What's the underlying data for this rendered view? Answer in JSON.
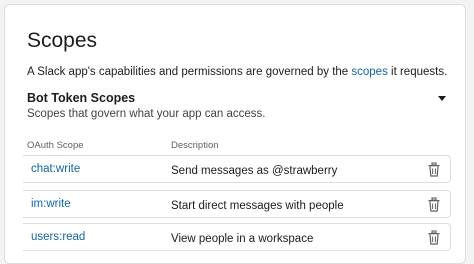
{
  "section": {
    "title": "Scopes",
    "description_prefix": "A Slack app's capabilities and permissions are governed by the ",
    "description_link": "scopes",
    "description_suffix": " it requests."
  },
  "bot_token_scopes": {
    "title": "Bot Token Scopes",
    "subtitle": "Scopes that govern what your app can access.",
    "columns": {
      "scope": "OAuth Scope",
      "description": "Description"
    },
    "rows": [
      {
        "scope": "chat:write",
        "description": "Send messages as @strawberry"
      },
      {
        "scope": "im:write",
        "description": "Start direct messages with people"
      },
      {
        "scope": "users:read",
        "description": "View people in a workspace"
      }
    ]
  },
  "colors": {
    "link": "#1264a3",
    "border": "#dddddd",
    "text": "#1d1c1d",
    "muted": "#616061"
  },
  "icons": {
    "collapse": "caret-down-icon",
    "remove": "trash-icon"
  }
}
